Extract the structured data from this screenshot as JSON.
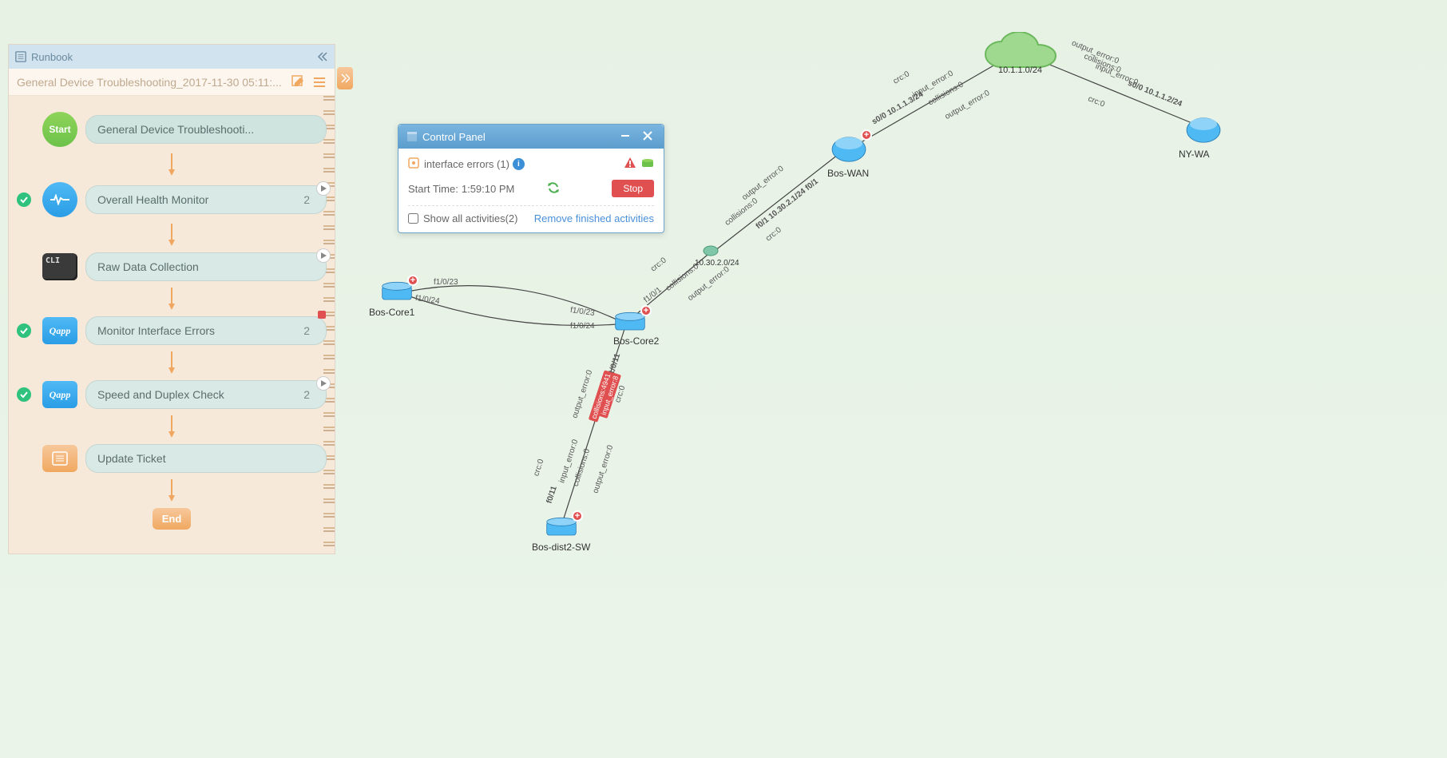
{
  "sidebar": {
    "title": "Runbook",
    "breadcrumb": "General Device Troubleshooting_2017-11-30 05:11:...",
    "start_label": "Start",
    "end_label": "End",
    "steps": [
      {
        "name": "General Device Troubleshooti...",
        "count": "",
        "icon": "start",
        "status": ""
      },
      {
        "name": "Overall Health Monitor",
        "count": "2",
        "icon": "health",
        "status": "done",
        "play": true
      },
      {
        "name": "Raw Data Collection",
        "count": "",
        "icon": "cli",
        "status": "",
        "play": true
      },
      {
        "name": "Monitor Interface Errors",
        "count": "2",
        "icon": "qapp",
        "status": "done",
        "record": true
      },
      {
        "name": "Speed and Duplex Check",
        "count": "2",
        "icon": "qapp",
        "status": "done",
        "play": true
      },
      {
        "name": "Update Ticket",
        "count": "",
        "icon": "ticket",
        "status": ""
      }
    ]
  },
  "controlPanel": {
    "title": "Control Panel",
    "activity": "interface errors (1)",
    "startTimeLabel": "Start Time:",
    "startTime": "1:59:10 PM",
    "stopLabel": "Stop",
    "showAllLabel": "Show all activities(2)",
    "removeLink": "Remove finished activities"
  },
  "topology": {
    "devices": {
      "bosCore1": "Bos-Core1",
      "bosCore2": "Bos-Core2",
      "bosDist2": "Bos-dist2-SW",
      "bosWan": "Bos-WAN",
      "nyWan": "NY-WA",
      "cloudSubnet": "10.1.1.0/24",
      "midSubnet": "10.30.2.0/24"
    },
    "linkLabels": {
      "c1_f1023": "f1/0/23",
      "c1_f1024": "f1/0/24",
      "c2_f1023": "f1/0/23",
      "c2_f1024": "f1/0/24",
      "c2_f101": "f1/0/1",
      "c2_f1011": "f1/0/11",
      "dist_f011": "f0/11",
      "wan_f01": "f0/1 10.30.2.1/24 f0/1",
      "wan_s00": "s0/0 10.1.1.3/24",
      "ny_s00": "s0/0 10.1.1.2/24",
      "crc": "crc:0",
      "inputErr": "input_error:0",
      "outputErr": "output_error:0",
      "collisions": "collisions:0",
      "collisionsErr": "collisions:4941",
      "inputErrBad": "input_error:8"
    }
  },
  "qapp_label": "Qapp",
  "cli_label": "CLI"
}
